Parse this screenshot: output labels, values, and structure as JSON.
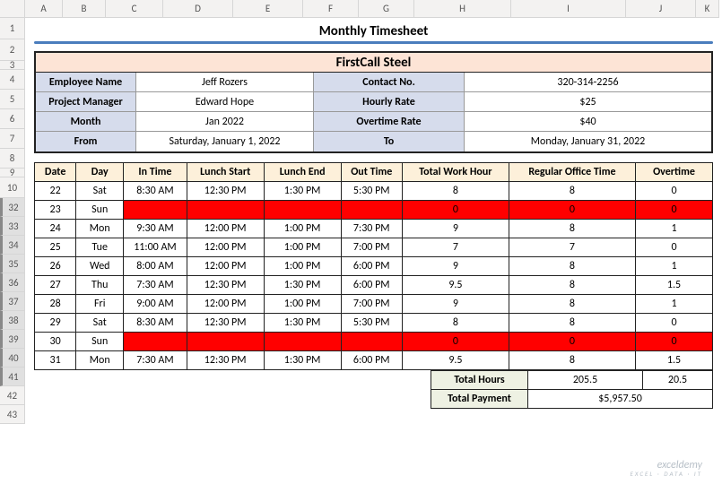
{
  "columns": [
    "",
    "A",
    "B",
    "C",
    "D",
    "E",
    "F",
    "G",
    "H",
    "I",
    "J",
    "K"
  ],
  "rowNumbers": [
    1,
    2,
    3,
    4,
    5,
    6,
    7,
    8,
    9,
    10,
    32,
    33,
    34,
    35,
    36,
    37,
    38,
    39,
    40,
    41,
    42,
    43
  ],
  "title": "Monthly Timesheet",
  "company": "FirstCall Steel",
  "info": {
    "employeeNameLabel": "Employee Name",
    "employeeName": "Jeff Rozers",
    "contactLabel": "Contact No.",
    "contact": "320-314-2256",
    "pmLabel": "Project Manager",
    "pm": "Edward Hope",
    "hourlyLabel": "Hourly Rate",
    "hourly": "$25",
    "monthLabel": "Month",
    "month": "Jan 2022",
    "otLabel": "Overtime Rate",
    "ot": "$40",
    "fromLabel": "From",
    "from": "Saturday, January 1, 2022",
    "toLabel": "To",
    "to": "Monday, January 31, 2022"
  },
  "headers": [
    "Date",
    "Day",
    "In Time",
    "Lunch Start",
    "Lunch End",
    "Out Time",
    "Total Work Hour",
    "Regular Office Time",
    "Overtime"
  ],
  "rows": [
    {
      "date": "22",
      "day": "Sat",
      "in": "8:30 AM",
      "ls": "12:30 PM",
      "le": "1:30 PM",
      "out": "5:30 PM",
      "twh": "8",
      "rot": "8",
      "ot": "0",
      "red": false
    },
    {
      "date": "23",
      "day": "Sun",
      "in": "",
      "ls": "",
      "le": "",
      "out": "",
      "twh": "0",
      "rot": "0",
      "ot": "0",
      "red": true
    },
    {
      "date": "24",
      "day": "Mon",
      "in": "9:30 AM",
      "ls": "12:00 PM",
      "le": "1:00 PM",
      "out": "7:30 PM",
      "twh": "9",
      "rot": "8",
      "ot": "1",
      "red": false
    },
    {
      "date": "25",
      "day": "Tue",
      "in": "11:00 AM",
      "ls": "12:00 PM",
      "le": "1:00 PM",
      "out": "7:00 PM",
      "twh": "7",
      "rot": "7",
      "ot": "0",
      "red": false
    },
    {
      "date": "26",
      "day": "Wed",
      "in": "8:00 AM",
      "ls": "12:00 PM",
      "le": "1:00 PM",
      "out": "6:00 PM",
      "twh": "9",
      "rot": "8",
      "ot": "1",
      "red": false
    },
    {
      "date": "27",
      "day": "Thu",
      "in": "7:30 AM",
      "ls": "12:30 PM",
      "le": "1:30 PM",
      "out": "6:00 PM",
      "twh": "9.5",
      "rot": "8",
      "ot": "1.5",
      "red": false
    },
    {
      "date": "28",
      "day": "Fri",
      "in": "9:00 AM",
      "ls": "12:00 PM",
      "le": "1:00 PM",
      "out": "7:00 PM",
      "twh": "9",
      "rot": "8",
      "ot": "1",
      "red": false
    },
    {
      "date": "29",
      "day": "Sat",
      "in": "8:30 AM",
      "ls": "12:30 PM",
      "le": "1:30 PM",
      "out": "5:30 PM",
      "twh": "8",
      "rot": "8",
      "ot": "0",
      "red": false
    },
    {
      "date": "30",
      "day": "Sun",
      "in": "",
      "ls": "",
      "le": "",
      "out": "",
      "twh": "0",
      "rot": "0",
      "ot": "0",
      "red": true
    },
    {
      "date": "31",
      "day": "Mon",
      "in": "7:30 AM",
      "ls": "12:30 PM",
      "le": "1:30 PM",
      "out": "6:00 PM",
      "twh": "9.5",
      "rot": "8",
      "ot": "1.5",
      "red": false
    }
  ],
  "totals": {
    "hoursLabel": "Total Hours",
    "regHours": "205.5",
    "otHours": "20.5",
    "paymentLabel": "Total Payment",
    "payment": "$5,957.50"
  },
  "watermark": {
    "main": "exceldemy",
    "sub": "EXCEL · DATA · IT"
  }
}
